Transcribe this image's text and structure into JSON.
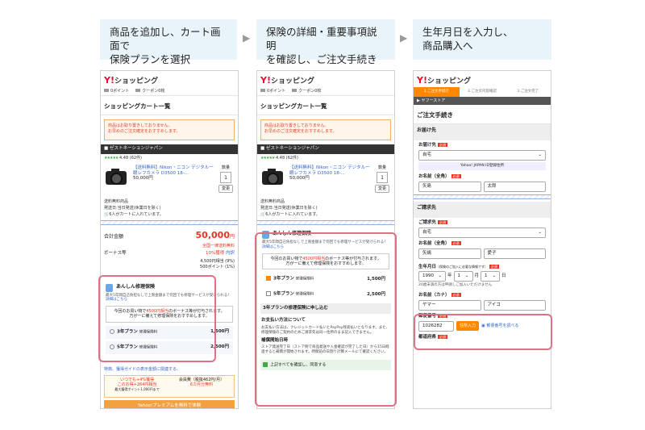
{
  "steps": [
    {
      "line1": "商品を追加し、カート画面で",
      "line2": "保険プランを選択"
    },
    {
      "line1": "保険の詳細・重要事項説明",
      "line2": "を確認し、ご注文手続きへ"
    },
    {
      "line1": "生年月日を入力し、",
      "line2": "商品購入へ"
    }
  ],
  "arrow": "▶",
  "common": {
    "logo_mark": "Y!",
    "logo_text": "ショッピング",
    "points_label": "0ポイント",
    "coupon_label": "クーポン0枚"
  },
  "p1": {
    "title": "ショッピングカート一覧",
    "notice1": "商品はお取り置きしておりません。",
    "notice2": "お早めのご注文確定をおすすめします。",
    "store": "ゼストネーションジャパン",
    "rating": "4.48 (62件)",
    "product_name": "【送料無料】Nikon・ニコン デジタル一眼レフカメラ D3500 18-...",
    "product_price": "50,000円",
    "qty_label": "数量",
    "qty_value": "1",
    "change_label": "変更",
    "ship1": "送料無料商品",
    "ship2": "発送日:当日発送(休業日を除く)",
    "cart_count": "6人がカートに入れています。",
    "total_label": "合計金額",
    "total_value": "50,000",
    "yen": "円",
    "total_note": "全国一律送料無料",
    "bonus_label": "ボーナス等",
    "bonus_value": "10%獲得",
    "bonus_detail": "内訳",
    "point1": "4,500円相当 (9%)",
    "point2": "500ポイント (1%)",
    "ins_title": "あんしん修理保険",
    "ins_desc": "最大5年間自己負担なしで上限金額まで何回でも修理サービスが受けられる！",
    "ins_link": "詳細はこちら",
    "ins_box1": "今回のお買い物で",
    "ins_box_bonus": "4500円相当",
    "ins_box1b": "のボーナス等が付与されます。",
    "ins_box2": "万が一に備えて修理保険をおすすめします。",
    "plan3": "3年プラン",
    "plan3_tag": "修理保険料",
    "plan3_price": "1,500円",
    "plan5": "5年プラン",
    "plan5_tag": "修理保険料",
    "plan5_price": "2,500円",
    "footer_note": "特典、獲得ガイドの表示金額に関連する。",
    "promo1": "いつでも+4%獲得",
    "promo2": "このお得+264円相当",
    "promo3": "最大獲得ポイント1,000円まで",
    "promo_side": "会員費（税抜462円/月）",
    "promo_side2": "6カ月分無料",
    "banner": "Yahoo!プレミアムを無料で体験"
  },
  "p2": {
    "title": "ショッピングカート一覧",
    "notice1": "商品はお取り置きしておりません。",
    "notice2": "お早めのご注文確定をおすすめします。",
    "store": "ゼストネーションジャパン",
    "rating": "4.48 (62件)",
    "product_name": "【送料無料】Nikon・ニコン デジタル一眼レフカメラ D3500 18-...",
    "product_price": "50,000円",
    "qty_label": "数量",
    "qty_value": "1",
    "change_label": "変更",
    "ship1": "送料無料商品",
    "ship2": "発送日:当日発送(休業日を除く)",
    "cart_count": "6人がカートに入れています。",
    "ins_title": "あんしん修理保険",
    "ins_desc": "最大5年間自己負担なしで上限金額まで何回でも修理サービスが受けられる！",
    "ins_link": "詳細はこちら",
    "ins_box1": "今回のお買い物で",
    "ins_box_bonus": "4500円相当",
    "ins_box1b": "のボーナス等が付与されます。",
    "ins_box2": "万が一に備えて修理保険をおすすめします。",
    "plan3": "3年プラン",
    "plan3_tag": "修理保険料",
    "plan3_price": "1,500円",
    "plan5": "5年プラン",
    "plan5_tag": "修理保険料",
    "plan5_price": "2,500円",
    "apply_title": "3年プランの修理保険に申し込む",
    "pay_head": "お支払い方法について",
    "pay_text": "お支払い方法は、クレジットカード払いとPayPay残高払いとなります。また、修理保険のご契約のためご請求先は同一住所のまま記入できません。",
    "period_head": "補償開始日時",
    "period_text": "ストア発送完了日（ストア側で商品発送や入金確認が完了した日）から15日経過すると補償が開始されます。時間前の日割り計算メールにて確認ください。",
    "agree": "上記すべてを確認し、同意する"
  },
  "p3": {
    "steps": [
      "1.ご注文手続き",
      "2.ご注文内容確認",
      "3.ご注文完了"
    ],
    "store": "ヤフーストア",
    "title": "ご注文手続き",
    "sec_delivery": "お届け先",
    "label_dest": "お届け先",
    "required": "必須",
    "dest_value": "自宅",
    "yahoo_addr": "Yahoo! JAPAN ID登録住所",
    "label_name": "お名前（全角）",
    "last_name": "矢島",
    "first_name": "太郎",
    "sec_billing": "ご請求先",
    "label_billing": "ご請求先",
    "billing_value": "自宅",
    "name_last2": "矢嶋",
    "name_first2": "愛子",
    "label_dob": "生年月日",
    "dob_note": "（保険のご加入に必要な情報です）",
    "dob_year": "1990",
    "dob_year_unit": "年",
    "dob_month": "1",
    "dob_month_unit": "月",
    "dob_day": "1",
    "dob_day_unit": "日",
    "dob_warn": "20歳未満の方は申請しご加入いただけません",
    "label_kana": "お名前（カナ）",
    "kana_last": "ヤマー",
    "kana_first": "アイコ",
    "label_zip": "郵便番号",
    "zip": "1026282",
    "zip_btn": "住所入力",
    "zip_link": "郵便番号を調べる",
    "label_pref": "都道府県"
  }
}
